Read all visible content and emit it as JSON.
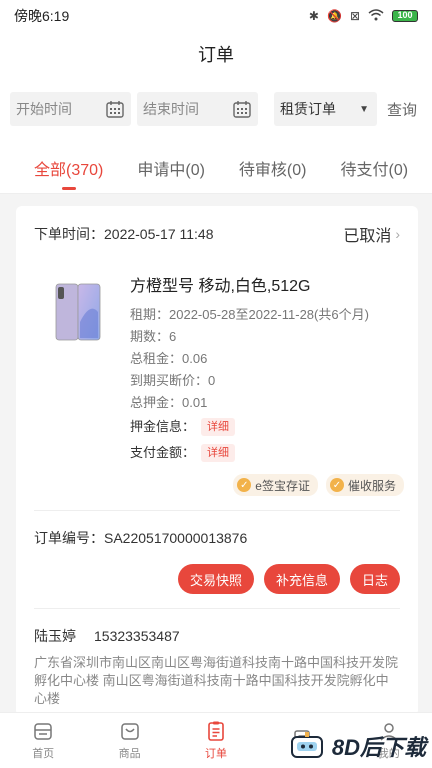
{
  "status_bar": {
    "time": "傍晚6:19",
    "battery": "100"
  },
  "header": {
    "title": "订单"
  },
  "filters": {
    "start_placeholder": "开始时间",
    "end_placeholder": "结束时间",
    "order_type": "租赁订单",
    "query_label": "查询"
  },
  "tabs": [
    {
      "label": "全部(370)"
    },
    {
      "label": "申请中(0)"
    },
    {
      "label": "待审核(0)"
    },
    {
      "label": "待支付(0)"
    }
  ],
  "order": {
    "time_label": "下单时间：",
    "time": "2022-05-17 11:48",
    "status": "已取消",
    "product": {
      "title": "方橙型号 移动,白色,512G",
      "lease_period": "租期：2022-05-28至2022-11-28(共6个月)",
      "periods": "期数：6",
      "total_rent": "总租金：0.06",
      "buyout_price": "到期买断价：0",
      "total_deposit": "总押金：0.01",
      "deposit_info_label": "押金信息：",
      "pay_amount_label": "支付金额：",
      "detail_tag": "详细"
    },
    "services": [
      {
        "label": "e签宝存证"
      },
      {
        "label": "催收服务"
      }
    ],
    "order_no_label": "订单编号：",
    "order_no": "SA2205170000013876",
    "actions": [
      {
        "label": "交易快照"
      },
      {
        "label": "补充信息"
      },
      {
        "label": "日志"
      }
    ],
    "contact_name": "陆玉婷",
    "contact_phone": "15323353487",
    "address": "广东省深圳市南山区南山区粤海街道科技南十路中国科技开发院孵化中心楼 南山区粤海街道科技南十路中国科技开发院孵化中心楼"
  },
  "tabbar": [
    {
      "label": "首页",
      "icon": "home-icon"
    },
    {
      "label": "商品",
      "icon": "bag-icon"
    },
    {
      "label": "订单",
      "icon": "order-icon"
    },
    {
      "label": "",
      "icon": "doc-icon"
    },
    {
      "label": "我的",
      "icon": "user-icon"
    }
  ],
  "watermark": {
    "text": "8D后下载"
  },
  "colors": {
    "accent": "#e8473c",
    "tag_bg": "#fdecea",
    "service_bg": "#faf1e5"
  }
}
